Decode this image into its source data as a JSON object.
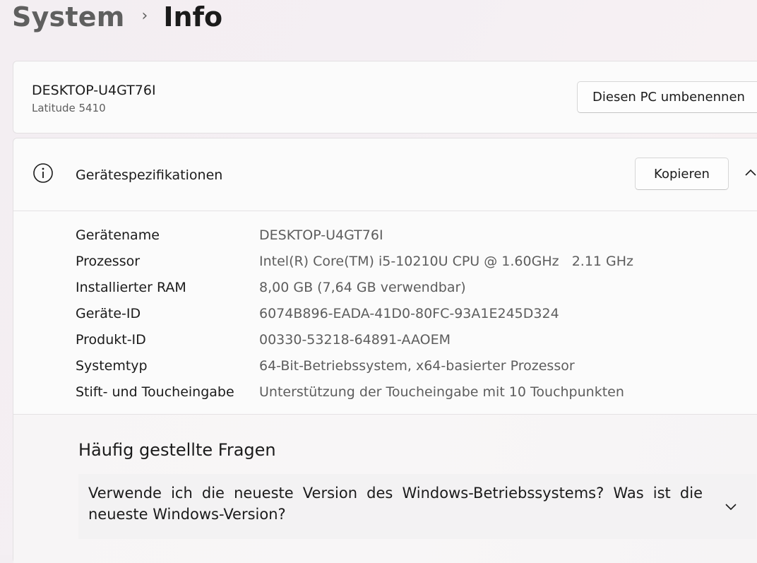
{
  "breadcrumb": {
    "parent": "System",
    "separator": "›",
    "current": "Info"
  },
  "device": {
    "name": "DESKTOP-U4GT76I",
    "model": "Latitude 5410",
    "rename_button": "Diesen PC umbenennen"
  },
  "specs": {
    "title": "Gerätespezifikationen",
    "copy_button": "Kopieren",
    "icon": "info-icon",
    "collapse_icon": "chevron-up-icon",
    "rows": [
      {
        "label": "Gerätename",
        "value": "DESKTOP-U4GT76I"
      },
      {
        "label": "Prozessor",
        "value": "Intel(R) Core(TM) i5-10210U CPU @ 1.60GHz   2.11 GHz"
      },
      {
        "label": "Installierter RAM",
        "value": "8,00 GB (7,64 GB verwendbar)"
      },
      {
        "label": "Geräte-ID",
        "value": "6074B896-EADA-41D0-80FC-93A1E245D324"
      },
      {
        "label": "Produkt-ID",
        "value": "00330-53218-64891-AAOEM"
      },
      {
        "label": "Systemtyp",
        "value": "64-Bit-Betriebssystem, x64-basierter Prozessor"
      },
      {
        "label": "Stift- und Toucheingabe",
        "value": "Unterstützung der Toucheingabe mit 10 Touchpunkten"
      }
    ]
  },
  "faq": {
    "title": "Häufig gestellte Fragen",
    "items": [
      {
        "question": "Verwende ich die neueste Version des Windows-Betriebssystems? Was ist die neueste Windows-Version?",
        "icon": "chevron-down-icon"
      }
    ]
  }
}
